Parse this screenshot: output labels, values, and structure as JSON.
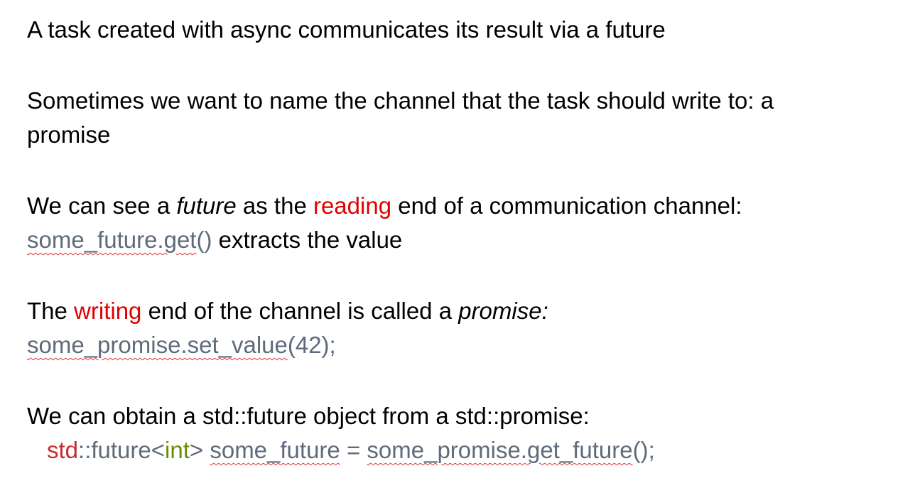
{
  "p1": {
    "text": "A task created with async communicates its result via a future"
  },
  "p2": {
    "line1": "Sometimes we want to name the channel that the task should write to: a",
    "line2": "promise"
  },
  "p3": {
    "pre": "We can see a ",
    "em": "future",
    "mid": " as the ",
    "highlight": "reading",
    "post": " end of a communication channel:",
    "code_ident": "some_future.get",
    "code_rest": "()",
    "line2_post": " extracts the value"
  },
  "p4": {
    "pre": "The ",
    "highlight": "writing",
    "mid": " end of the channel is called a ",
    "em": "promise:",
    "code_ident": "some_promise.set_value",
    "code_rest": "(42);"
  },
  "p5": {
    "line1": "We can obtain a std::future object from a std::promise:",
    "code_std": "std",
    "code_scope": "::future<",
    "code_int": "int",
    "code_gt": "> ",
    "code_var": "some_future",
    "code_eq": " = ",
    "code_call": "some_promise.get_future",
    "code_end": "();"
  },
  "colors": {
    "highlight": "#e00000",
    "code": "#5e6b7b",
    "std_keyword": "#c92a2a",
    "int_keyword": "#6b8e00",
    "spellcheck": "#e23030"
  }
}
